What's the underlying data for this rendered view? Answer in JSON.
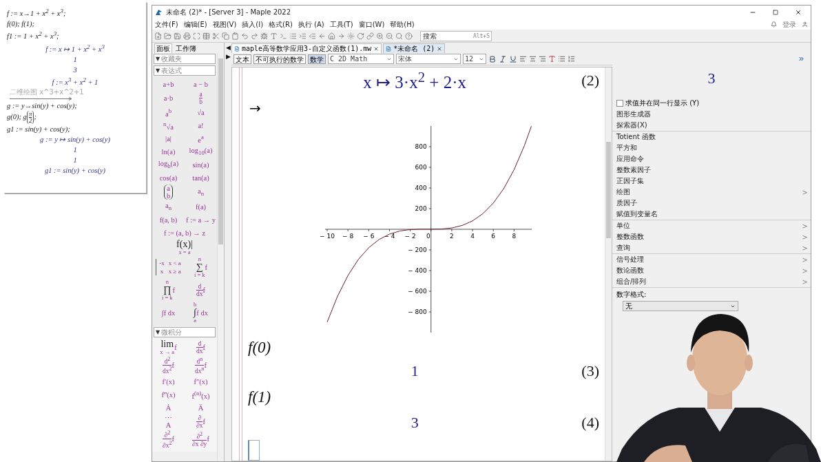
{
  "left_notebook": {
    "lines": [
      {
        "kind": "input",
        "text": "f := x→1 + x$^{2}$ + x$^{3}$;"
      },
      {
        "kind": "input",
        "text": "f(0); f(1);"
      },
      {
        "kind": "input",
        "text": "f1 := 1 + x$^{2}$ + x$^{3}$;"
      },
      {
        "kind": "output",
        "text": "f := x ↦ 1 + x$^{2}$ + x$^{3}$"
      },
      {
        "kind": "output",
        "text": "1"
      },
      {
        "kind": "output",
        "text": "3"
      },
      {
        "kind": "output",
        "text": "f := x$^{3}$ + x$^{2}$ + 1"
      },
      {
        "kind": "plot_arrow",
        "text": "二维绘图 x^3+x^2+1"
      },
      {
        "kind": "input",
        "text": "g := y→sin(y) + cos(y);"
      },
      {
        "kind": "frac_call",
        "text": "g(0); g",
        "num": "π",
        "den": "2",
        "suffix": ";"
      },
      {
        "kind": "input",
        "text": "g1 := sin(y) + cos(y);"
      },
      {
        "kind": "output",
        "text": "g := y ↦ sin(y) + cos(y)"
      },
      {
        "kind": "output",
        "text": "1"
      },
      {
        "kind": "output",
        "text": "1"
      },
      {
        "kind": "output",
        "text": "g1 := sin(y) + cos(y)"
      }
    ]
  },
  "window": {
    "title": "未命名 (2)* - [Server 3] - Maple 2022",
    "login": "登录"
  },
  "menu": [
    "文件(F)",
    "编辑(E)",
    "视图(V)",
    "插入(I)",
    "格式(R)",
    "执行 (A)",
    "工具(T)",
    "窗口(W)",
    "帮助(H)"
  ],
  "search": {
    "placeholder": "搜索",
    "shortcut": "Alt+S"
  },
  "panel_tabs": [
    {
      "label": "面板",
      "selected": true
    },
    {
      "label": "工作簿",
      "selected": false
    }
  ],
  "panel_toggles": [
    "◀",
    "▶"
  ],
  "doc_tabs": [
    {
      "label": "maple高等数学应用3-自定义函数(1).mw",
      "selected": false
    },
    {
      "label": "*未命名 (2)",
      "selected": true
    }
  ],
  "palette_sections": [
    {
      "toggle": "▼",
      "title": "收藏夹"
    },
    {
      "toggle": "▼",
      "title": "表达式",
      "items": [
        {
          "kind": "text",
          "text": "a+b"
        },
        {
          "kind": "text",
          "text": "a − b"
        },
        {
          "kind": "text",
          "text": "a·b"
        },
        {
          "kind": "frac",
          "num": "a",
          "den": "b"
        },
        {
          "kind": "text",
          "text": "a$^{b}$"
        },
        {
          "kind": "text",
          "text": "√a"
        },
        {
          "kind": "text",
          "text": "$^{n}$√a"
        },
        {
          "kind": "text",
          "text": "a!"
        },
        {
          "kind": "text",
          "text": "|a|"
        },
        {
          "kind": "text",
          "text": "e$^{a}$"
        },
        {
          "kind": "text",
          "text": "ln(a)"
        },
        {
          "kind": "text",
          "text": "log$_{10}$(a)"
        },
        {
          "kind": "text",
          "text": "log$_{b}$(a)"
        },
        {
          "kind": "text",
          "text": "sin(a)"
        },
        {
          "kind": "text",
          "text": "cos(a)"
        },
        {
          "kind": "text",
          "text": "tan(a)"
        },
        {
          "kind": "binom",
          "num": "a",
          "den": "b"
        },
        {
          "kind": "text",
          "text": "a$_{n}$"
        },
        {
          "kind": "text",
          "text": "a$_{n}$"
        },
        {
          "kind": "text",
          "text": "f(a)"
        },
        {
          "kind": "text",
          "text": "f(a, b)"
        },
        {
          "kind": "text",
          "text": "f := a → y"
        },
        {
          "kind": "text",
          "text": "f := (a, b) → z",
          "wide": true
        },
        {
          "kind": "big",
          "symbol": "f(x)|",
          "lower": "x = a",
          "wide": true
        },
        {
          "kind": "cases",
          "rows": [
            [
              "-x",
              "x < a"
            ],
            [
              "x",
              "x ≥ a"
            ]
          ]
        },
        {
          "kind": "big",
          "symbol": "∑",
          "upper": "n",
          "lower": "i = k",
          "body": "f"
        },
        {
          "kind": "big",
          "symbol": "∏",
          "upper": "n",
          "lower": "i = k",
          "body": "f"
        },
        {
          "kind": "frac",
          "num": "d",
          "den": "dx",
          "body": "f"
        },
        {
          "kind": "text",
          "text": "∫f dx"
        },
        {
          "kind": "big",
          "symbol": "∫",
          "upper": "b",
          "lower": "a",
          "body": "f dx"
        }
      ]
    },
    {
      "toggle": "▼",
      "title": "微积分",
      "items": [
        {
          "kind": "big",
          "symbol": "lim",
          "lower": "x → a",
          "body": "f"
        },
        {
          "kind": "frac",
          "num": "d",
          "den": "dx",
          "body": "f"
        },
        {
          "kind": "frac",
          "num": "d$^{2}$",
          "den": "dx$^{2}$",
          "body": "f"
        },
        {
          "kind": "frac",
          "num": "d$^{n}$",
          "den": "dx$^{n}$",
          "body": "f"
        },
        {
          "kind": "text",
          "text": "f′(x)"
        },
        {
          "kind": "text",
          "text": "f″(x)"
        },
        {
          "kind": "text",
          "text": "f‴(x)"
        },
        {
          "kind": "text",
          "text": "f$^{(n)}$(x)"
        },
        {
          "kind": "text",
          "text": "Ȧ"
        },
        {
          "kind": "text",
          "text": "Ä"
        },
        {
          "kind": "accent",
          "accent": "⋯",
          "base": "A"
        },
        {
          "kind": "frac",
          "num": "∂",
          "den": "∂x",
          "body": "f"
        },
        {
          "kind": "frac",
          "num": "∂$^{2}$",
          "den": "∂x$^{2}$",
          "body": "f"
        },
        {
          "kind": "frac",
          "num": "∂$^{2}$",
          "den": "∂x ∂y",
          "body": "f"
        }
      ]
    }
  ],
  "format_bar": {
    "modes": [
      {
        "label": "文本",
        "selected": false
      },
      {
        "label": "不可执行的数学",
        "selected": false
      },
      {
        "label": "数学",
        "selected": true
      }
    ],
    "style_icon": "C",
    "style": "2D Math",
    "font": "宋体",
    "size": "12"
  },
  "document": {
    "blocks": [
      {
        "kind": "output",
        "math": "x ↦ 3·x$^{2}$ + 2·x",
        "label": "(2)"
      },
      {
        "kind": "arrow",
        "text": "→"
      },
      {
        "kind": "plot",
        "chart_data": {
          "type": "line",
          "x": [
            -10,
            -9,
            -8,
            -7,
            -6,
            -5,
            -4,
            -3,
            -2,
            -1,
            0,
            1,
            2,
            3,
            4,
            5,
            6,
            7,
            8,
            9,
            9.67
          ],
          "series": [
            {
              "color": "#6b1e2a",
              "values": [
                -899,
                -647,
                -447,
                -293,
                -179,
                -99,
                -47,
                -17,
                -3,
                1,
                1,
                3,
                13,
                37,
                81,
                151,
                253,
                393,
                577,
                811,
                999
              ]
            }
          ],
          "xlim": [
            -10.2,
            9.7
          ],
          "ylim": [
            -1000,
            1000
          ],
          "xticks": [
            -10,
            -8,
            -6,
            -4,
            -2,
            0,
            2,
            4,
            6,
            8
          ],
          "yticks": [
            -800,
            -600,
            -400,
            -200,
            200,
            400,
            600,
            800
          ]
        }
      },
      {
        "kind": "input",
        "math": "f(0)"
      },
      {
        "kind": "output",
        "math": "1",
        "label": "(3)"
      },
      {
        "kind": "input",
        "math": "f(1)"
      },
      {
        "kind": "output",
        "math": "3",
        "label": "(4)"
      },
      {
        "kind": "cursor"
      }
    ]
  },
  "context_panel": {
    "expand": "»",
    "result": "3",
    "evaluate_inline": {
      "label": "求值并在同一行显示 (Y)",
      "checked": false
    },
    "groups": [
      [
        {
          "label": "图形生成器"
        },
        {
          "label": "探索器(X)"
        }
      ],
      [
        {
          "label": "Totient 函数"
        },
        {
          "label": "平方和"
        },
        {
          "label": "应用命令"
        },
        {
          "label": "整数素因子"
        },
        {
          "label": "正因子集"
        },
        {
          "label": "绘图",
          "arrow": ">"
        },
        {
          "label": "质因子"
        },
        {
          "label": "赋值到变量名"
        }
      ],
      [
        {
          "label": "单位",
          "arrow": ">"
        },
        {
          "label": "整数函数",
          "arrow": ">"
        },
        {
          "label": "查询",
          "arrow": ">"
        }
      ],
      [
        {
          "label": "信号处理",
          "arrow": ">"
        },
        {
          "label": "数论函数",
          "arrow": ">"
        },
        {
          "label": "组合/排列",
          "arrow": ">"
        }
      ]
    ],
    "number_format": {
      "label": "数字格式:",
      "value": "无"
    }
  },
  "video": {
    "kind": "picture"
  }
}
